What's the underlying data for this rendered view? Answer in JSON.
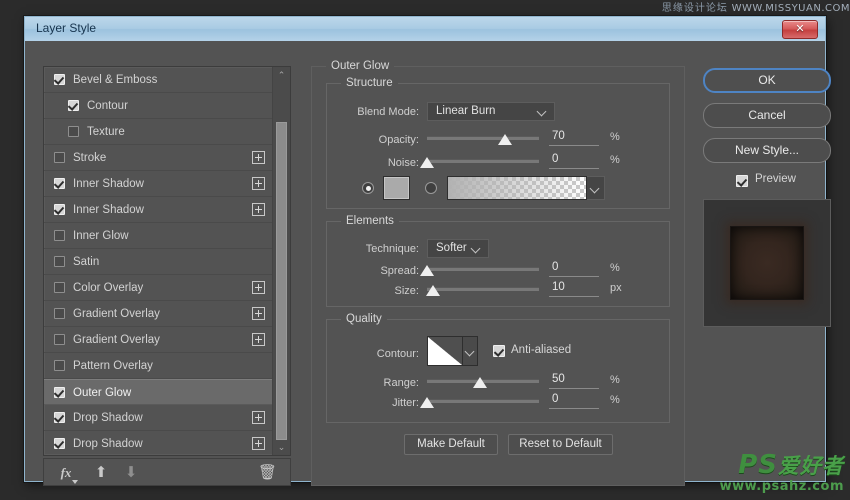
{
  "window": {
    "title": "Layer Style",
    "close_label": "✕"
  },
  "watermarks": {
    "top": {
      "cn": "思缘设计论坛",
      "url": "WWW.MISSYUAN.COM"
    },
    "bottom": {
      "ps": "PS",
      "cn": "爱好者",
      "url": "www.psahz.com"
    }
  },
  "styles_list": {
    "items": [
      {
        "label": "Bevel & Emboss",
        "checked": true,
        "sub": false,
        "plus": false,
        "selected": false
      },
      {
        "label": "Contour",
        "checked": true,
        "sub": true,
        "plus": false,
        "selected": false
      },
      {
        "label": "Texture",
        "checked": false,
        "sub": true,
        "plus": false,
        "selected": false
      },
      {
        "label": "Stroke",
        "checked": false,
        "sub": false,
        "plus": true,
        "selected": false
      },
      {
        "label": "Inner Shadow",
        "checked": true,
        "sub": false,
        "plus": true,
        "selected": false
      },
      {
        "label": "Inner Shadow",
        "checked": true,
        "sub": false,
        "plus": true,
        "selected": false
      },
      {
        "label": "Inner Glow",
        "checked": false,
        "sub": false,
        "plus": false,
        "selected": false
      },
      {
        "label": "Satin",
        "checked": false,
        "sub": false,
        "plus": false,
        "selected": false
      },
      {
        "label": "Color Overlay",
        "checked": false,
        "sub": false,
        "plus": true,
        "selected": false
      },
      {
        "label": "Gradient Overlay",
        "checked": false,
        "sub": false,
        "plus": true,
        "selected": false
      },
      {
        "label": "Gradient Overlay",
        "checked": false,
        "sub": false,
        "plus": true,
        "selected": false
      },
      {
        "label": "Pattern Overlay",
        "checked": false,
        "sub": false,
        "plus": false,
        "selected": false
      },
      {
        "label": "Outer Glow",
        "checked": true,
        "sub": false,
        "plus": false,
        "selected": true
      },
      {
        "label": "Drop Shadow",
        "checked": true,
        "sub": false,
        "plus": true,
        "selected": false
      },
      {
        "label": "Drop Shadow",
        "checked": true,
        "sub": false,
        "plus": true,
        "selected": false
      }
    ],
    "toolbar": {
      "fx_label": "fx",
      "up_glyph": "⬆",
      "down_glyph": "⬇",
      "trash_glyph": "🗑"
    },
    "scrollbar": {
      "up_glyph": "⌃",
      "down_glyph": "⌄"
    }
  },
  "panel": {
    "title": "Outer Glow",
    "structure": {
      "title": "Structure",
      "blend_mode_label": "Blend Mode:",
      "blend_mode_value": "Linear Burn",
      "opacity_label": "Opacity:",
      "opacity_value": "70",
      "opacity_unit": "%",
      "noise_label": "Noise:",
      "noise_value": "0",
      "noise_unit": "%",
      "fill_type": "color",
      "color_swatch": "#aaaaaa"
    },
    "elements": {
      "title": "Elements",
      "technique_label": "Technique:",
      "technique_value": "Softer",
      "spread_label": "Spread:",
      "spread_value": "0",
      "spread_unit": "%",
      "size_label": "Size:",
      "size_value": "10",
      "size_unit": "px"
    },
    "quality": {
      "title": "Quality",
      "contour_label": "Contour:",
      "antialiased_label": "Anti-aliased",
      "antialiased_checked": true,
      "range_label": "Range:",
      "range_value": "50",
      "range_unit": "%",
      "jitter_label": "Jitter:",
      "jitter_value": "0",
      "jitter_unit": "%"
    },
    "buttons": {
      "make_default": "Make Default",
      "reset_to_default": "Reset to Default"
    }
  },
  "right": {
    "ok": "OK",
    "cancel": "Cancel",
    "new_style": "New Style...",
    "preview_label": "Preview",
    "preview_checked": true,
    "accent": "#4e84c4"
  }
}
